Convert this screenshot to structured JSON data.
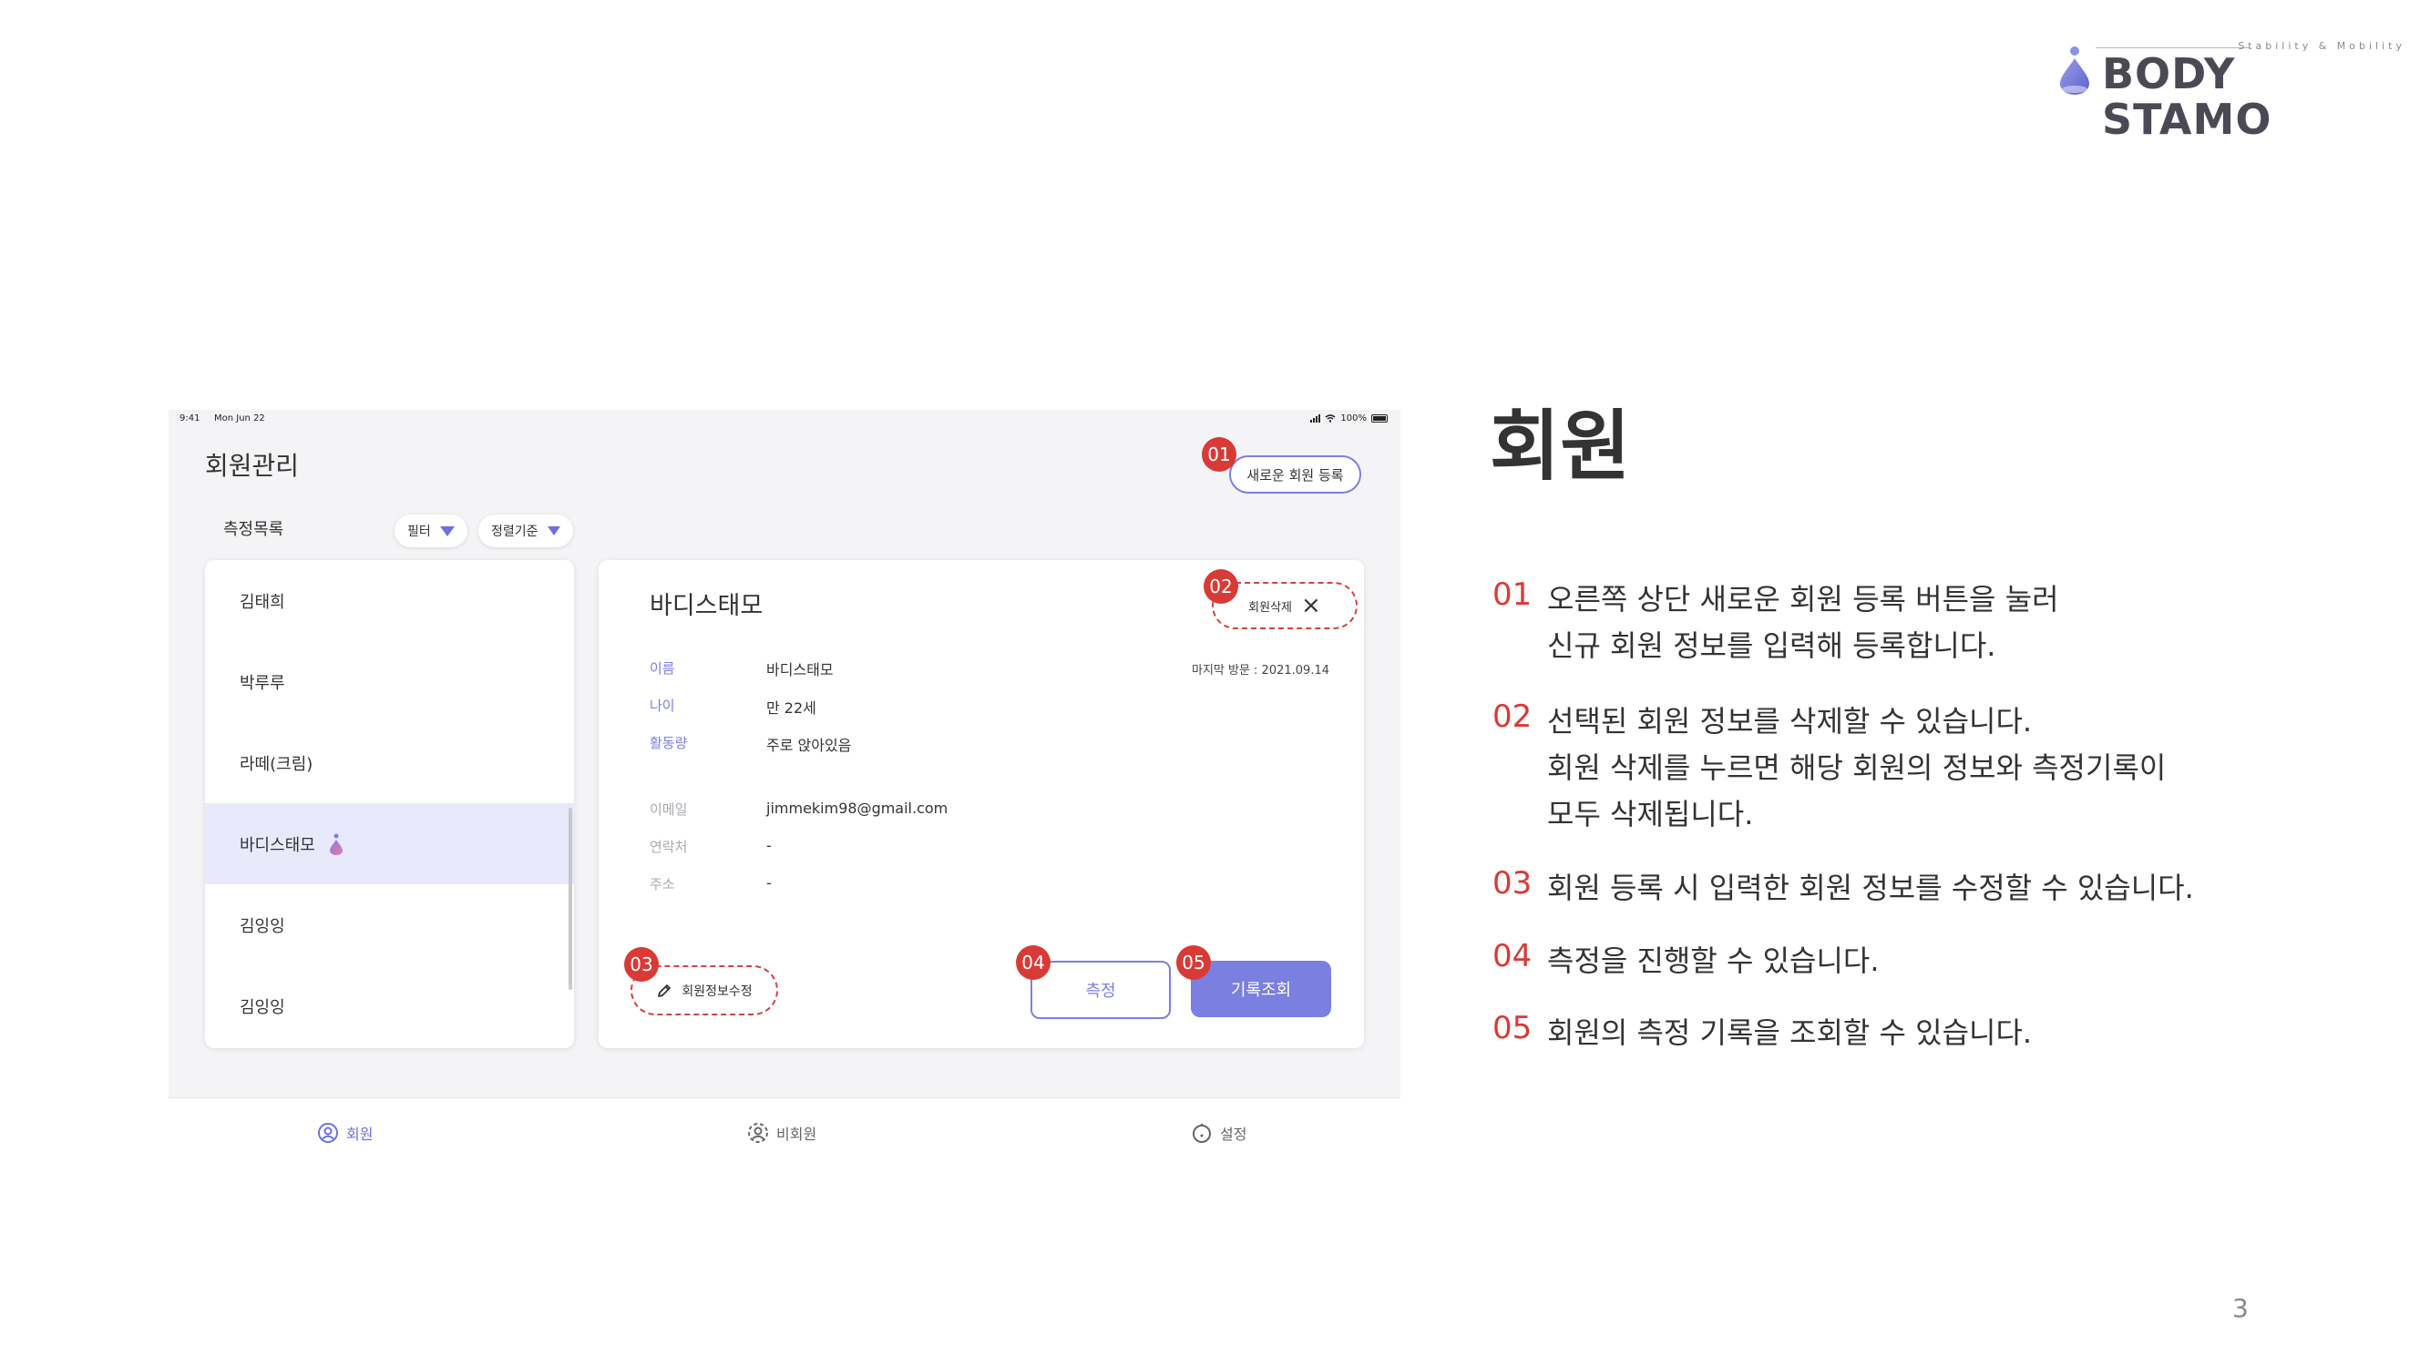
{
  "brand": {
    "tagline": "Stability & Mobility",
    "wordmark": "BODY STAMO",
    "colors": {
      "accent": "#7b7fe0",
      "marker": "#d93a35"
    }
  },
  "tablet": {
    "status": {
      "time": "9:41",
      "date": "Mon Jun 22",
      "battery": "100%"
    },
    "page_title": "회원관리",
    "new_member_button": "새로운 회원 등록",
    "list_title": "측정목록",
    "filter_chip": "필터",
    "sort_chip": "정렬기준",
    "members": [
      {
        "name": "김태희"
      },
      {
        "name": "박루루"
      },
      {
        "name": "라떼(크림)"
      },
      {
        "name": "바디스태모"
      },
      {
        "name": "김잉잉"
      },
      {
        "name": "김잉잉"
      }
    ],
    "selected_member_index": 3,
    "detail": {
      "name": "바디스태모",
      "delete_button": "회원삭제",
      "last_visit": "마지막 방문 : 2021.09.14",
      "fields": {
        "name_label": "이름",
        "name_value": "바디스태모",
        "age_label": "나이",
        "age_value": "만 22세",
        "activity_label": "활동량",
        "activity_value": "주로 앉아있음",
        "email_label": "이메일",
        "email_value": "jimmekim98@gmail.com",
        "phone_label": "연락처",
        "phone_value": "-",
        "address_label": "주소",
        "address_value": "-"
      },
      "edit_button": "회원정보수정",
      "measure_button": "측정",
      "history_button": "기록조회"
    },
    "tabs": {
      "members": "회원",
      "non_members": "비회원",
      "settings": "설정"
    },
    "markers": [
      "01",
      "02",
      "03",
      "04",
      "05"
    ]
  },
  "panel": {
    "heading": "회원",
    "items": [
      {
        "num": "01",
        "lines": [
          "오른쪽 상단 새로운 회원 등록 버튼을 눌러",
          "신규 회원 정보를 입력해 등록합니다."
        ]
      },
      {
        "num": "02",
        "lines": [
          "선택된 회원 정보를 삭제할 수 있습니다.",
          "회원 삭제를 누르면 해당 회원의 정보와 측정기록이",
          "모두 삭제됩니다."
        ]
      },
      {
        "num": "03",
        "lines": [
          "회원 등록 시 입력한 회원 정보를 수정할 수 있습니다."
        ]
      },
      {
        "num": "04",
        "lines": [
          "측정을 진행할 수 있습니다."
        ]
      },
      {
        "num": "05",
        "lines": [
          "회원의 측정 기록을 조회할 수 있습니다."
        ]
      }
    ]
  },
  "page_number": "3"
}
